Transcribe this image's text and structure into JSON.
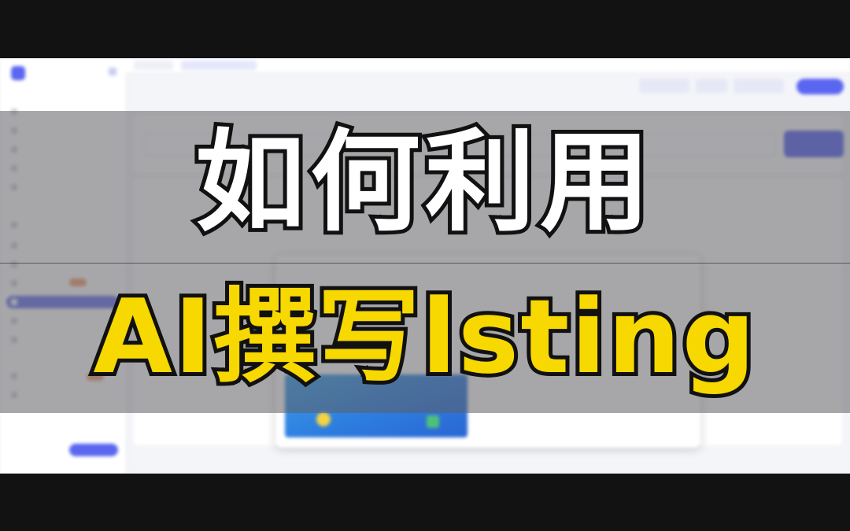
{
  "video_title": {
    "line1": "如何利用",
    "line2": "AI撰写lsting"
  },
  "colors": {
    "title_line1": "#ffffff",
    "title_line2": "#f7d800",
    "title_outline": "#111111",
    "accent": "#5a66f0"
  },
  "icons": {
    "logo": "app-logo-icon",
    "collapse": "sidebar-collapse-icon"
  }
}
